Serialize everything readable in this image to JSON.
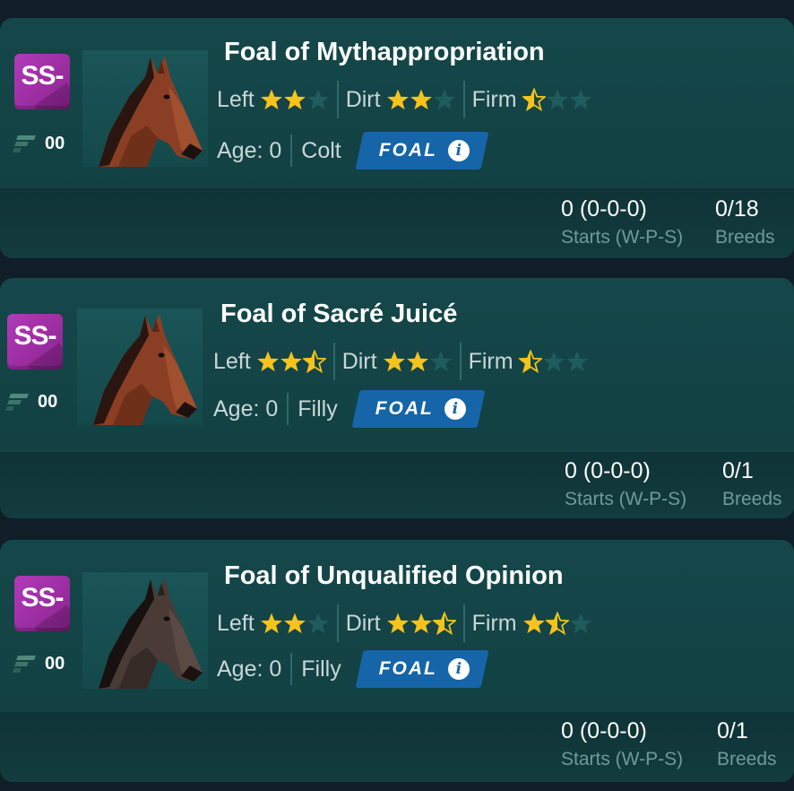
{
  "colors": {
    "card_background": "#15474a",
    "page_background": "#0f1e27",
    "grade_badge": "#a22ea8",
    "star_filled": "#f6c31c",
    "star_empty": "#1f5c5e",
    "foal_badge": "#1565a8",
    "caption_text": "#6e9a9d"
  },
  "horses": [
    {
      "name": "Foal of Mythappropriation",
      "grade": "SS-",
      "flag_icon": "flag-icon",
      "flag_number": "00",
      "coat": "bay",
      "stats": [
        {
          "label": "Left",
          "stars": 2
        },
        {
          "label": "Dirt",
          "stars": 2
        },
        {
          "label": "Firm",
          "stars": 0.5
        }
      ],
      "age": "Age: 0",
      "sex": "Colt",
      "status_badge": "FOAL",
      "info_icon": "info-icon",
      "record": {
        "value": "0 (0-0-0)",
        "caption": "Starts (W-P-S)"
      },
      "breeds": {
        "value": "0/18",
        "caption": "Breeds"
      }
    },
    {
      "name": "Foal of Sacré Juicé",
      "grade": "SS-",
      "flag_icon": "flag-icon",
      "flag_number": "00",
      "coat": "bay",
      "stats": [
        {
          "label": "Left",
          "stars": 2.5
        },
        {
          "label": "Dirt",
          "stars": 2
        },
        {
          "label": "Firm",
          "stars": 0.5
        }
      ],
      "age": "Age: 0",
      "sex": "Filly",
      "status_badge": "FOAL",
      "info_icon": "info-icon",
      "record": {
        "value": "0 (0-0-0)",
        "caption": "Starts (W-P-S)"
      },
      "breeds": {
        "value": "0/1",
        "caption": "Breeds"
      }
    },
    {
      "name": "Foal of Unqualified Opinion",
      "grade": "SS-",
      "flag_icon": "flag-icon",
      "flag_number": "00",
      "coat": "dark",
      "stats": [
        {
          "label": "Left",
          "stars": 2
        },
        {
          "label": "Dirt",
          "stars": 2.5
        },
        {
          "label": "Firm",
          "stars": 1.5
        }
      ],
      "age": "Age: 0",
      "sex": "Filly",
      "status_badge": "FOAL",
      "info_icon": "info-icon",
      "record": {
        "value": "0 (0-0-0)",
        "caption": "Starts (W-P-S)"
      },
      "breeds": {
        "value": "0/1",
        "caption": "Breeds"
      }
    }
  ]
}
